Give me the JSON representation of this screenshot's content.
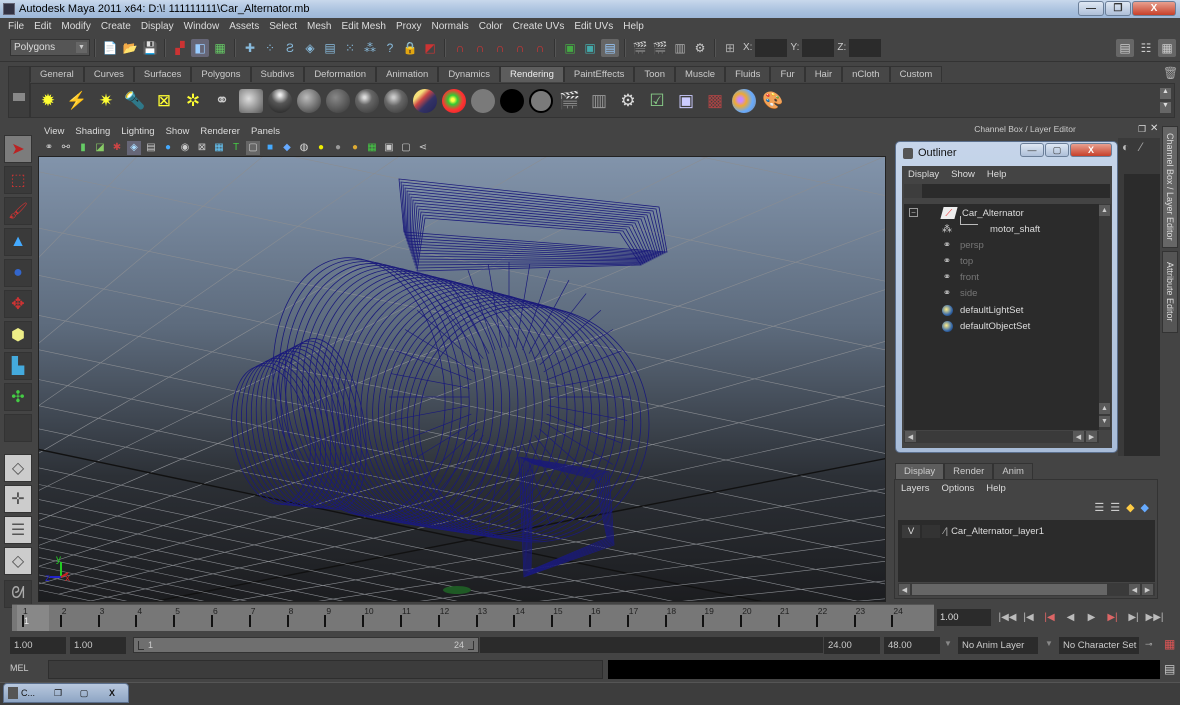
{
  "window": {
    "title": "Autodesk Maya 2011 x64: D:\\! 111111111\\Car_Alternator.mb",
    "min_label": "—",
    "max_label": "❐",
    "close_label": "X"
  },
  "menubar": [
    "File",
    "Edit",
    "Modify",
    "Create",
    "Display",
    "Window",
    "Assets",
    "Select",
    "Mesh",
    "Edit Mesh",
    "Proxy",
    "Normals",
    "Color",
    "Create UVs",
    "Edit UVs",
    "Help"
  ],
  "statusline": {
    "menuset": "Polygons",
    "x_label": "X:",
    "y_label": "Y:",
    "z_label": "Z:",
    "x_value": "",
    "y_value": "",
    "z_value": ""
  },
  "shelf": {
    "tabs": [
      "General",
      "Curves",
      "Surfaces",
      "Polygons",
      "Subdivs",
      "Deformation",
      "Animation",
      "Dynamics",
      "Rendering",
      "PaintEffects",
      "Toon",
      "Muscle",
      "Fluids",
      "Fur",
      "Hair",
      "nCloth",
      "Custom"
    ],
    "active_tab": "Rendering"
  },
  "viewport": {
    "menu": [
      "View",
      "Shading",
      "Lighting",
      "Show",
      "Renderer",
      "Panels"
    ],
    "wire_color": "#1a1a7a",
    "axis_labels": {
      "y": "y",
      "x": "x",
      "z": "z"
    }
  },
  "right_panel": {
    "header": "Channel Box / Layer Editor",
    "side_tabs": [
      "Channel Box / Layer Editor",
      "Attribute Editor"
    ]
  },
  "outliner": {
    "title": "Outliner",
    "menu": [
      "Display",
      "Show",
      "Help"
    ],
    "filter_value": "",
    "items": [
      {
        "label": "Car_Alternator",
        "icon": "transform-icon",
        "dim": false,
        "depth": 0,
        "expander": "−"
      },
      {
        "label": "motor_shaft",
        "icon": "mesh-icon",
        "dim": false,
        "depth": 1
      },
      {
        "label": "persp",
        "icon": "camera-icon",
        "dim": true,
        "depth": 0
      },
      {
        "label": "top",
        "icon": "camera-icon",
        "dim": true,
        "depth": 0
      },
      {
        "label": "front",
        "icon": "camera-icon",
        "dim": true,
        "depth": 0
      },
      {
        "label": "side",
        "icon": "camera-icon",
        "dim": true,
        "depth": 0
      },
      {
        "label": "defaultLightSet",
        "icon": "set-icon",
        "dim": false,
        "depth": 0
      },
      {
        "label": "defaultObjectSet",
        "icon": "set-icon",
        "dim": false,
        "depth": 0
      }
    ]
  },
  "layer_editor": {
    "tabs": [
      "Display",
      "Render",
      "Anim"
    ],
    "active_tab": "Display",
    "menu": [
      "Layers",
      "Options",
      "Help"
    ],
    "layers": [
      {
        "visible": "V",
        "name": "Car_Alternator_layer1"
      }
    ]
  },
  "timeline": {
    "ticks": [
      "1",
      "2",
      "3",
      "4",
      "5",
      "6",
      "7",
      "8",
      "9",
      "10",
      "11",
      "12",
      "13",
      "14",
      "15",
      "16",
      "17",
      "18",
      "19",
      "20",
      "21",
      "22",
      "23",
      "24"
    ],
    "current_frame_marker": "1",
    "current_time": "1.00"
  },
  "range": {
    "start_time": "1.00",
    "playback_start": "1.00",
    "slider_start": "1",
    "slider_end": "24",
    "playback_end": "24.00",
    "end_time": "48.00",
    "anim_layer": "No Anim Layer",
    "character_set": "No Character Set"
  },
  "cmdline": {
    "label": "MEL",
    "input": "",
    "output": ""
  },
  "minimized_window": {
    "label": "C..."
  }
}
